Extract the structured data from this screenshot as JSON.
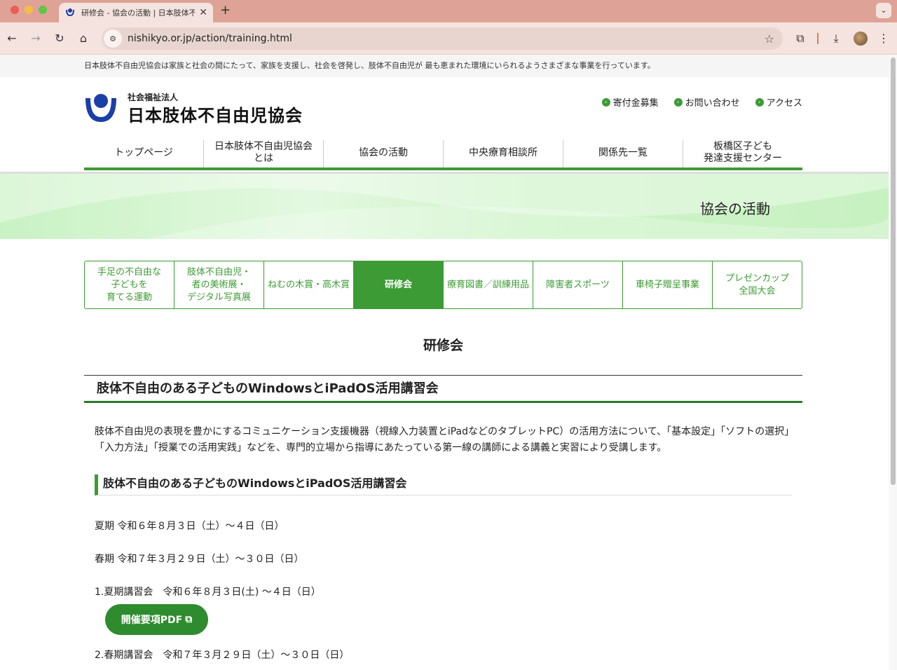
{
  "browser": {
    "tab_title": "研修会 - 協会の活動 | 日本肢体不自由児協会",
    "tab_close": "✕",
    "new_tab": "+",
    "tab_menu": "⌄",
    "url": "nishikyo.or.jp/action/training.html",
    "back_icon": "←",
    "forward_icon": "→",
    "reload_icon": "↻",
    "home_icon": "⌂",
    "site_info_icon": "⚙",
    "bookmark_icon": "☆",
    "extensions_icon": "⧉",
    "download_icon": "⤓",
    "menu_icon": "⋮"
  },
  "topbar": {
    "text": "日本肢体不自由児協会は家族と社会の間にたって、家族を支援し、社会を啓発し、肢体不自由児が 最も恵まれた環境にいられるようさまざまな事業を行っています。"
  },
  "header": {
    "logo_sub": "社会福祉法人",
    "logo_main": "日本肢体不自由児協会",
    "util_links": [
      "寄付金募集",
      "お問い合わせ",
      "アクセス"
    ],
    "util_bullet": "›"
  },
  "gnav": {
    "items": [
      "トップページ",
      "日本肢体不自由児協会\nとは",
      "協会の活動",
      "中央療育相談所",
      "関係先一覧",
      "板橋区子ども\n発達支援センター"
    ]
  },
  "hero": {
    "title": "協会の活動"
  },
  "subnav": {
    "items": [
      "手足の不自由な\n子どもを\n育てる運動",
      "肢体不自由児・\n者の美術展・\nデジタル写真展",
      "ねむの木賞・高木賞",
      "研修会",
      "療育図書／訓練用品",
      "障害者スポーツ",
      "車椅子贈呈事業",
      "プレゼンカップ\n全国大会"
    ],
    "active_index": 3
  },
  "content": {
    "h1": "研修会",
    "h2": "肢体不自由のある子どものWindowsとiPadOS活用講習会",
    "intro": "肢体不自由児の表現を豊かにするコミュニケーション支援機器（視線入力装置とiPadなどのタブレットPC）の活用方法について、「基本設定」「ソフトの選択」「入力方法」「授業での活用実践」などを、専門的立場から指導にあたっている第一線の講師による講義と実習により受講します。",
    "h3": "肢体不自由のある子どものWindowsとiPadOS活用講習会",
    "summer": "夏期 令和６年８月３日（土）～４日（日）",
    "spring": "春期 令和７年３月２９日（土）～３０日（日）",
    "item1": "1.夏期講習会　令和６年８月３日(土) ～４日（日）",
    "pdf_button": "開催要項PDF",
    "pdf_icon": "⧉",
    "item2": "2.春期講習会　令和７年３月２９日（土）～３０日（日）"
  },
  "colors": {
    "accent_green": "#3c9b34",
    "logo_blue": "#1b3fa8",
    "chrome_pink": "#dea396"
  }
}
